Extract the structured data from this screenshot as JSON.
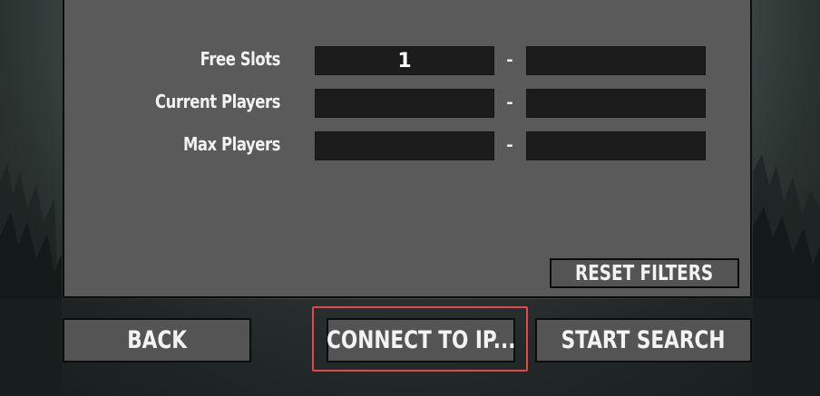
{
  "colors": {
    "panel": "#5a5a5a",
    "field": "#1c1c1c",
    "button": "#545454",
    "border": "#0c0c0c",
    "text": "#f2f2f2",
    "highlight": "#e5474b"
  },
  "filters": {
    "rows": [
      {
        "label": "Free Slots",
        "min_value": "1",
        "max_value": ""
      },
      {
        "label": "Current Players",
        "min_value": "",
        "max_value": ""
      },
      {
        "label": "Max Players",
        "min_value": "",
        "max_value": ""
      }
    ],
    "separator": "-",
    "reset_label": "RESET FILTERS"
  },
  "footer": {
    "back_label": "BACK",
    "connect_label": "CONNECT TO IP...",
    "start_search_label": "START SEARCH"
  }
}
